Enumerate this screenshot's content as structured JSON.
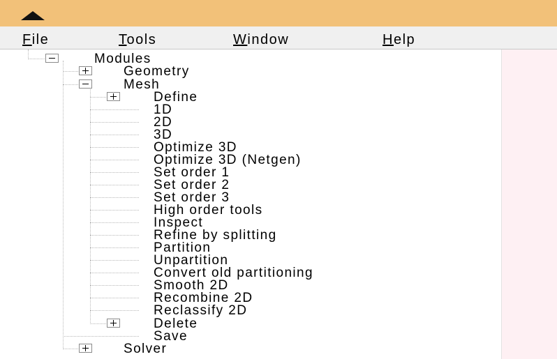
{
  "menubar": {
    "file": {
      "mnemonic": "F",
      "rest": "ile"
    },
    "tools": {
      "mnemonic": "T",
      "rest": "ools"
    },
    "window": {
      "mnemonic": "W",
      "rest": "indow"
    },
    "help": {
      "mnemonic": "H",
      "rest": "elp"
    }
  },
  "tree": {
    "modules": "Modules",
    "geometry": "Geometry",
    "mesh": "Mesh",
    "define": "Define",
    "mesh_items": [
      "1D",
      "2D",
      "3D",
      "Optimize 3D",
      "Optimize 3D (Netgen)",
      "Set order 1",
      "Set order 2",
      "Set order 3",
      "High order tools",
      "Inspect",
      "Refine by splitting",
      "Partition",
      "Unpartition",
      "Convert old partitioning",
      "Smooth 2D",
      "Recombine 2D",
      "Reclassify 2D"
    ],
    "delete": "Delete",
    "save": "Save",
    "solver": "Solver"
  }
}
